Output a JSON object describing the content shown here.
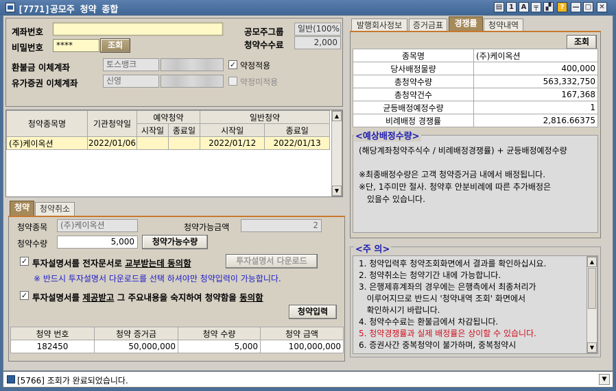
{
  "window": {
    "title": "[7771]공모주 청약 종합",
    "controls": [
      "▤",
      "1",
      "A",
      "╤",
      "▞",
      "?",
      "—",
      "▢",
      "✕"
    ]
  },
  "account": {
    "account_label": "계좌번호",
    "password_label": "비밀번호",
    "password_value": "****",
    "query_button": "조회",
    "group_label": "공모주그룹",
    "group_value": "일반(100%)",
    "fee_label": "청약수수료",
    "fee_value": "2,000",
    "refund_label": "환불금 이체계좌",
    "refund_bank": "토스뱅크",
    "terms_apply": "약정적용",
    "securities_label": "유가증권 이체계좌",
    "securities_bank": "신영",
    "terms_not_apply": "약정미적용"
  },
  "schedule": {
    "headers": {
      "name": "청약종목명",
      "inst": "기관청약일",
      "reserve": "예약청약",
      "general": "일반청약",
      "start": "시작일",
      "end": "종료일"
    },
    "rows": [
      {
        "name": "(주)케이옥션",
        "inst": "2022/01/06",
        "res_start": "",
        "res_end": "",
        "gen_start": "2022/01/12",
        "gen_end": "2022/01/13"
      }
    ]
  },
  "order_tabs": [
    "청약",
    "청약취소"
  ],
  "order": {
    "stock_label": "청약종목",
    "stock_value": "(주)케이옥션",
    "avail_label": "청약가능금액",
    "avail_value": "2",
    "qty_label": "청약수량",
    "qty_value": "5,000",
    "qty_button": "청약가능수량",
    "consent1_a": "투자설명서를 전자문서로 ",
    "consent1_b": "교부받는데 동의함",
    "download_button": "투자설명서 다운로드",
    "download_notice": "※ 반드시 투자설명서 다운로드를 선택 하셔야만 청약입력이 가능합니다.",
    "consent2_a": "투자설명서를 ",
    "consent2_b": "제공받고",
    "consent2_c": " 그 주요내용을 숙지하여 청약함을 ",
    "consent2_d": "동의함",
    "submit_button": "청약입력"
  },
  "result": {
    "headers": [
      "청약 번호",
      "청약 증거금",
      "청약 수량",
      "청약 금액"
    ],
    "row": [
      "182450",
      "50,000,000",
      "5,000",
      "100,000,000"
    ]
  },
  "right_tabs": [
    "발행회사정보",
    "증거금표",
    "경쟁률",
    "청약내역"
  ],
  "competition": {
    "query_button": "조회",
    "rows": [
      [
        "종목명",
        "(주)케이옥션"
      ],
      [
        "당사배정물량",
        "400,000"
      ],
      [
        "총청약수량",
        "563,332,750"
      ],
      [
        "총청약건수",
        "167,368"
      ],
      [
        "균등배정예정수량",
        "1"
      ],
      [
        "비례배정 경쟁률",
        "2,816.66375"
      ]
    ]
  },
  "expected": {
    "title": "<예상배정수량>",
    "formula": "(해당계좌청약주식수 / 비례배정경쟁률) + 균등배정예정수량",
    "note1": "※최종배정수량은 고객 청약증거금 내에서 배정됩니다.",
    "note2": "※단, 1주미만 절사. 청약후 안분비례에 따른 추가배정은",
    "note3": "있을수 있습니다."
  },
  "caution": {
    "title": "<주  의>",
    "lines": [
      "1. 청약입력후 청약조회화면에서 결과를 확인하십시요.",
      "2. 청약취소는 청약기간 내에 가능합니다.",
      "3. 은행제휴계좌의 경우에는 은행측에서 최종처리가",
      "   이루어지므로 반드시 '청약내역 조회' 화면에서",
      "   확인하시기 바랍니다.",
      "4. 청약수수료는 환불금에서 차감됩니다.",
      "5. 청약경쟁률과 실제 배정률은 상이할 수 있습니다.",
      "6. 증권사간 중복청약이 불가하며, 중복청약시"
    ],
    "highlight_color": "#d0101e"
  },
  "status": {
    "code": "[5766]",
    "message": "조회가 완료되었습니다."
  }
}
